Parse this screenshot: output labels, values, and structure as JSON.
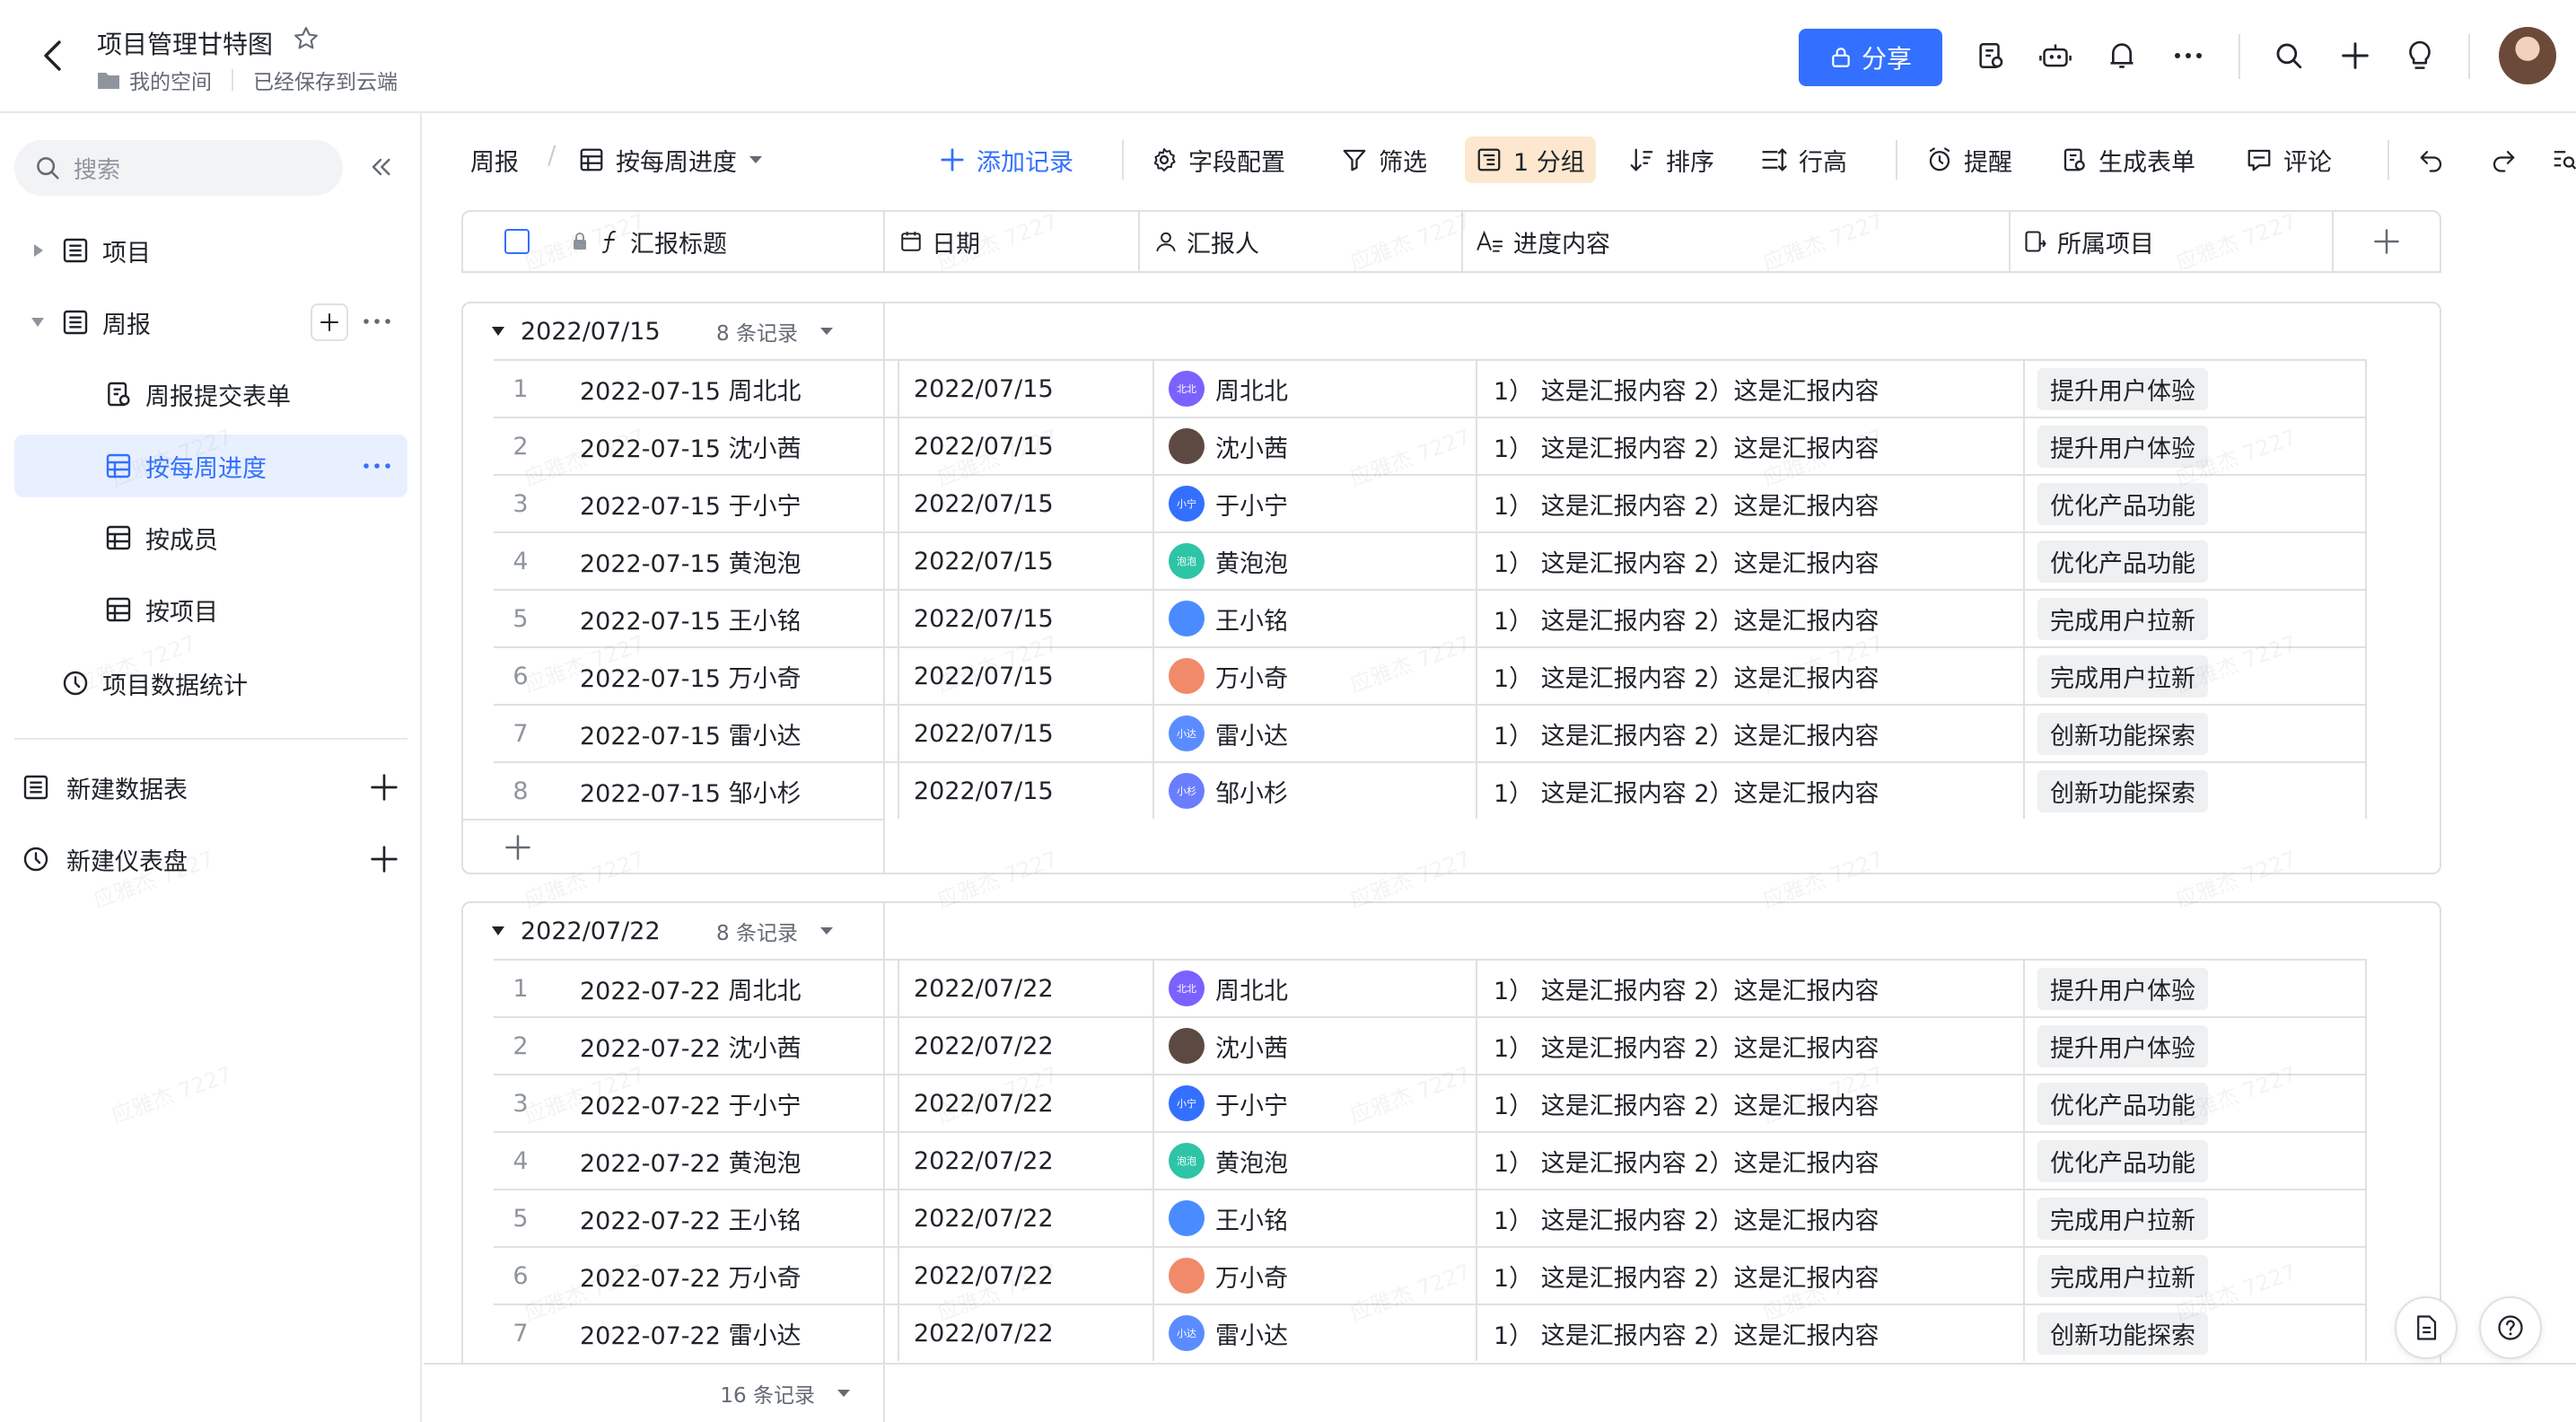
{
  "app": {
    "doc_title": "项目管理甘特图",
    "location": "我的空间",
    "save_status": "已经保存到云端",
    "share_label": "分享",
    "brand_color": "#3370ff"
  },
  "topbar_icons": [
    "form-icon",
    "robot-icon",
    "bell-icon",
    "more-icon",
    "search-icon",
    "plus-icon",
    "bulb-icon"
  ],
  "sidebar": {
    "search_placeholder": "搜索",
    "tree": [
      {
        "label": "项目"
      },
      {
        "label": "周报"
      },
      {
        "label": "周报提交表单"
      },
      {
        "label": "按每周进度"
      },
      {
        "label": "按成员"
      },
      {
        "label": "按项目"
      },
      {
        "label": "项目数据统计"
      }
    ],
    "new_table": "新建数据表",
    "new_dashboard": "新建仪表盘"
  },
  "toolbar": {
    "table_name": "周报",
    "view_name": "按每周进度",
    "add_record": "添加记录",
    "field_config": "字段配置",
    "filter": "筛选",
    "group": "1 分组",
    "sort": "排序",
    "row_height": "行高",
    "reminder": "提醒",
    "gen_form": "生成表单",
    "comment": "评论"
  },
  "columns": [
    "汇报标题",
    "日期",
    "汇报人",
    "进度内容",
    "所属项目"
  ],
  "groups": [
    {
      "label": "2022/07/15",
      "count": "8 条记录",
      "rows": [
        {
          "no": "1",
          "title": "2022-07-15 周北北",
          "date": "2022/07/15",
          "person": "周北北",
          "av": "北北",
          "content": "1） 这是汇报内容 2）这是汇报内容",
          "project": "提升用户体验"
        },
        {
          "no": "2",
          "title": "2022-07-15 沈小茜",
          "date": "2022/07/15",
          "person": "沈小茜",
          "av": "",
          "content": "1） 这是汇报内容 2）这是汇报内容",
          "project": "提升用户体验"
        },
        {
          "no": "3",
          "title": "2022-07-15 于小宁",
          "date": "2022/07/15",
          "person": "于小宁",
          "av": "小宁",
          "content": "1） 这是汇报内容 2）这是汇报内容",
          "project": "优化产品功能"
        },
        {
          "no": "4",
          "title": "2022-07-15 黄泡泡",
          "date": "2022/07/15",
          "person": "黄泡泡",
          "av": "泡泡",
          "content": "1） 这是汇报内容 2）这是汇报内容",
          "project": "优化产品功能"
        },
        {
          "no": "5",
          "title": "2022-07-15 王小铭",
          "date": "2022/07/15",
          "person": "王小铭",
          "av": "",
          "content": "1） 这是汇报内容 2）这是汇报内容",
          "project": "完成用户拉新"
        },
        {
          "no": "6",
          "title": "2022-07-15 万小奇",
          "date": "2022/07/15",
          "person": "万小奇",
          "av": "",
          "content": "1） 这是汇报内容 2）这是汇报内容",
          "project": "完成用户拉新"
        },
        {
          "no": "7",
          "title": "2022-07-15 雷小达",
          "date": "2022/07/15",
          "person": "雷小达",
          "av": "小达",
          "content": "1） 这是汇报内容 2）这是汇报内容",
          "project": "创新功能探索"
        },
        {
          "no": "8",
          "title": "2022-07-15 邹小杉",
          "date": "2022/07/15",
          "person": "邹小杉",
          "av": "小杉",
          "content": "1） 这是汇报内容 2）这是汇报内容",
          "project": "创新功能探索"
        }
      ]
    },
    {
      "label": "2022/07/22",
      "count": "8 条记录",
      "rows": [
        {
          "no": "1",
          "title": "2022-07-22 周北北",
          "date": "2022/07/22",
          "person": "周北北",
          "av": "北北",
          "content": "1） 这是汇报内容 2）这是汇报内容",
          "project": "提升用户体验"
        },
        {
          "no": "2",
          "title": "2022-07-22 沈小茜",
          "date": "2022/07/22",
          "person": "沈小茜",
          "av": "",
          "content": "1） 这是汇报内容 2）这是汇报内容",
          "project": "提升用户体验"
        },
        {
          "no": "3",
          "title": "2022-07-22 于小宁",
          "date": "2022/07/22",
          "person": "于小宁",
          "av": "小宁",
          "content": "1） 这是汇报内容 2）这是汇报内容",
          "project": "优化产品功能"
        },
        {
          "no": "4",
          "title": "2022-07-22 黄泡泡",
          "date": "2022/07/22",
          "person": "黄泡泡",
          "av": "泡泡",
          "content": "1） 这是汇报内容 2）这是汇报内容",
          "project": "优化产品功能"
        },
        {
          "no": "5",
          "title": "2022-07-22 王小铭",
          "date": "2022/07/22",
          "person": "王小铭",
          "av": "",
          "content": "1） 这是汇报内容 2）这是汇报内容",
          "project": "完成用户拉新"
        },
        {
          "no": "6",
          "title": "2022-07-22 万小奇",
          "date": "2022/07/22",
          "person": "万小奇",
          "av": "",
          "content": "1） 这是汇报内容 2）这是汇报内容",
          "project": "完成用户拉新"
        },
        {
          "no": "7",
          "title": "2022-07-22 雷小达",
          "date": "2022/07/22",
          "person": "雷小达",
          "av": "小达",
          "content": "1） 这是汇报内容 2）这是汇报内容",
          "project": "创新功能探索"
        }
      ]
    }
  ],
  "avatar_colors": {
    "周北北": "#7b61ff",
    "沈小茜": "#5c4a42",
    "于小宁": "#3370ff",
    "黄泡泡": "#2ec4a6",
    "王小铭": "#4a8cff",
    "万小奇": "#f08a6a",
    "雷小达": "#5b8cff",
    "邹小杉": "#6a7dff"
  },
  "footer": {
    "total": "16 条记录"
  },
  "watermark": "应雅杰 7227"
}
